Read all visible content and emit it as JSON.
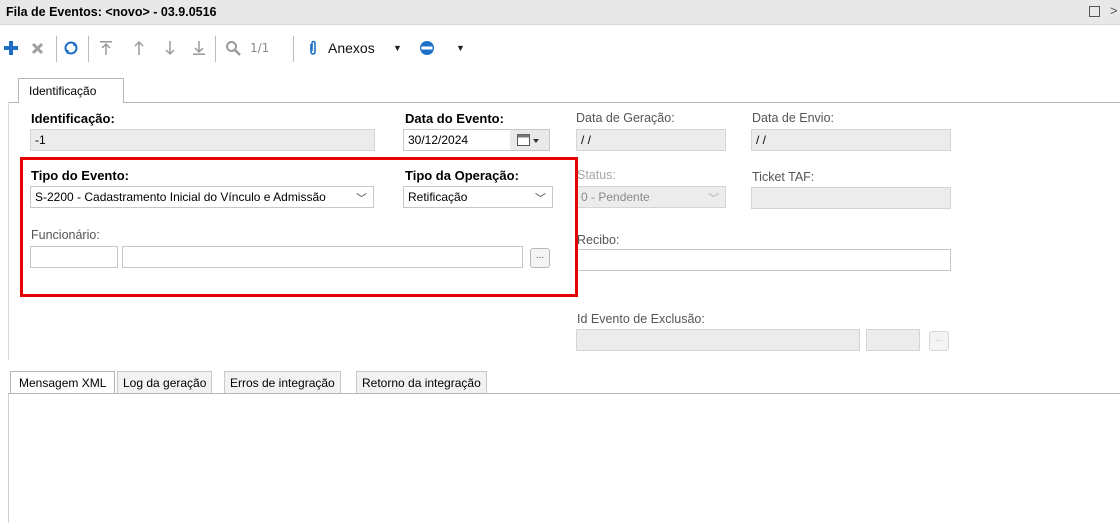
{
  "window": {
    "title": "Fila de Eventos: <novo> - 03.9.0516"
  },
  "toolbar": {
    "pager": "1/1",
    "anexos_label": "Anexos"
  },
  "tabs_top": {
    "identificacao": "Identificação"
  },
  "form": {
    "identificacao": {
      "label": "Identificação:",
      "value": "-1"
    },
    "data_evento": {
      "label": "Data do Evento:",
      "value": "30/12/2024"
    },
    "data_geracao": {
      "label": "Data de Geração:",
      "value": "/ /"
    },
    "data_envio": {
      "label": "Data de Envio:",
      "value": "/ /"
    },
    "tipo_evento": {
      "label": "Tipo do Evento:",
      "value": "S-2200 - Cadastramento Inicial do Vínculo e Admissão"
    },
    "tipo_operacao": {
      "label": "Tipo da Operação:",
      "value": "Retificação"
    },
    "status": {
      "label": "Status:",
      "value": "0 - Pendente"
    },
    "ticket_taf": {
      "label": "Ticket TAF:",
      "value": ""
    },
    "funcionario": {
      "label": "Funcionário:",
      "code": "",
      "name": ""
    },
    "recibo": {
      "label": "Recibo:",
      "value": ""
    },
    "id_evento_exclusao": {
      "label": "Id Evento de Exclusão:",
      "value": "",
      "value2": ""
    },
    "lookup_label": "..."
  },
  "tabs_bottom": {
    "items": [
      "Mensagem XML",
      "Log da geração",
      "Erros de integração",
      "Retorno da integração"
    ]
  },
  "colors": {
    "highlight": "#e60000",
    "toolbar_blue": "#1f6fc6"
  }
}
